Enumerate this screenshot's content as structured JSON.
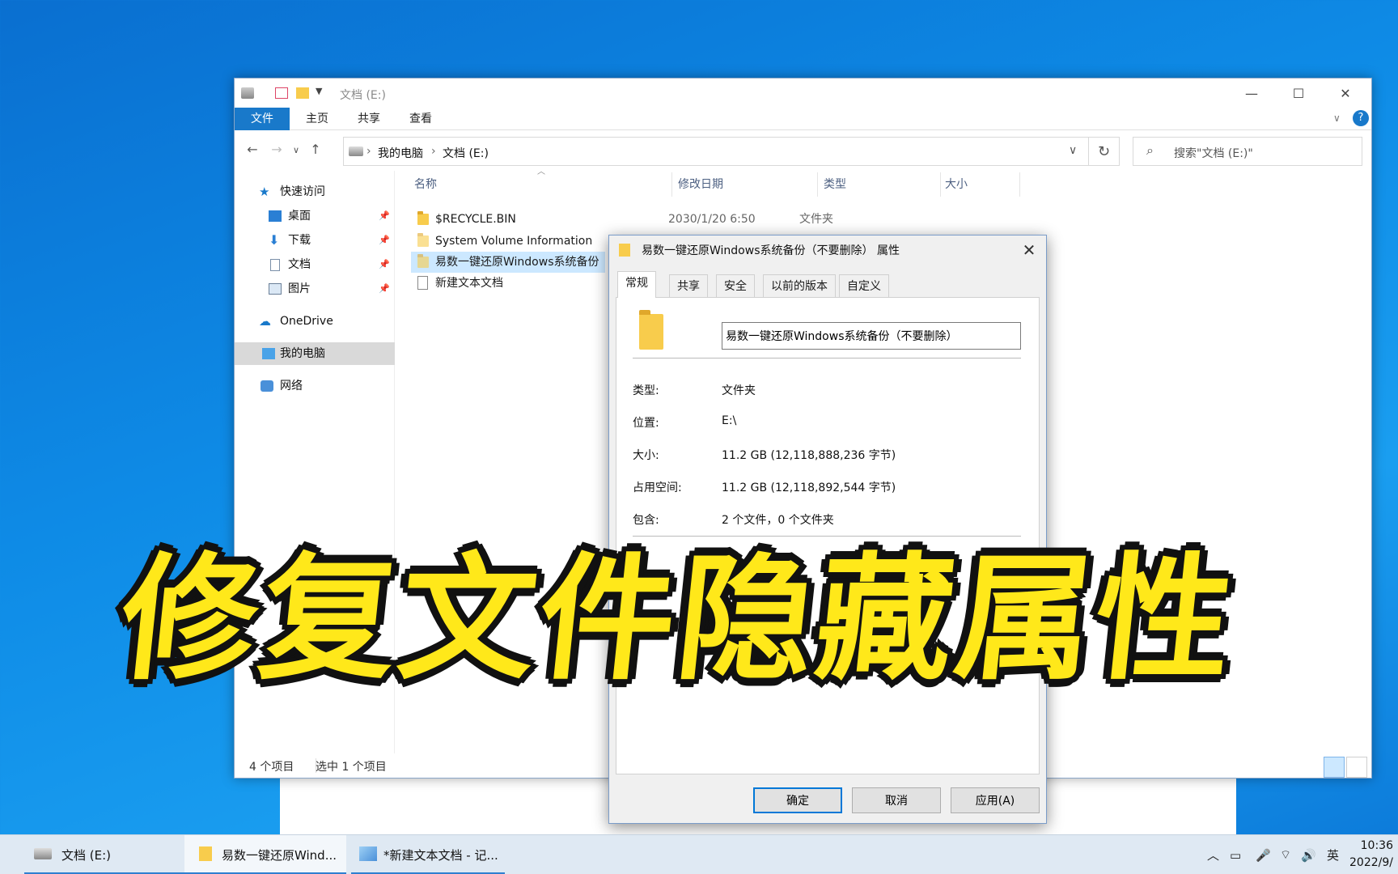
{
  "explorer": {
    "title": "文档 (E:)",
    "ribbon_tabs": [
      "文件",
      "主页",
      "共享",
      "查看"
    ],
    "breadcrumb": [
      "我的电脑",
      "文档 (E:)"
    ],
    "search_placeholder": "搜索\"文档 (E:)\"",
    "sidebar": {
      "quick_access": "快速访问",
      "desktop": "桌面",
      "downloads": "下载",
      "documents": "文档",
      "pictures": "图片",
      "onedrive": "OneDrive",
      "this_pc": "我的电脑",
      "network": "网络"
    },
    "columns": {
      "name": "名称",
      "date": "修改日期",
      "type": "类型",
      "size": "大小"
    },
    "files": [
      {
        "name": "$RECYCLE.BIN",
        "date": "2030/1/20 6:50",
        "type": "文件夹"
      },
      {
        "name": "System Volume Information",
        "date": "",
        "type": ""
      },
      {
        "name": "易数一键还原Windows系统备份",
        "date": "",
        "type": ""
      },
      {
        "name": "新建文本文档",
        "date": "",
        "type": ""
      }
    ],
    "status": {
      "count": "4 个项目",
      "selected": "选中 1 个项目"
    }
  },
  "dialog": {
    "title": "易数一键还原Windows系统备份（不要删除）  属性",
    "tabs": [
      "常规",
      "共享",
      "安全",
      "以前的版本",
      "自定义"
    ],
    "name_value": "易数一键还原Windows系统备份（不要删除）",
    "props": {
      "type_label": "类型:",
      "type_value": "文件夹",
      "location_label": "位置:",
      "location_value": "E:\\",
      "size_label": "大小:",
      "size_value": "11.2 GB (12,118,888,236 字节)",
      "disk_label": "占用空间:",
      "disk_value": "11.2 GB (12,118,892,544 字节)",
      "contains_label": "包含:",
      "contains_value": "2 个文件，0 个文件夹"
    },
    "buttons": {
      "ok": "确定",
      "cancel": "取消",
      "apply": "应用(A)"
    }
  },
  "overlay_caption": "修复文件隐藏属性",
  "taskbar": {
    "apps": [
      "文档 (E:)",
      "易数一键还原Wind...",
      "*新建文本文档 - 记..."
    ],
    "ime": "英",
    "time": "10:36",
    "date": "2022/9/"
  },
  "colors": {
    "accent": "#1979ca",
    "caption_fill": "#ffe81a",
    "caption_outline": "#111111"
  }
}
